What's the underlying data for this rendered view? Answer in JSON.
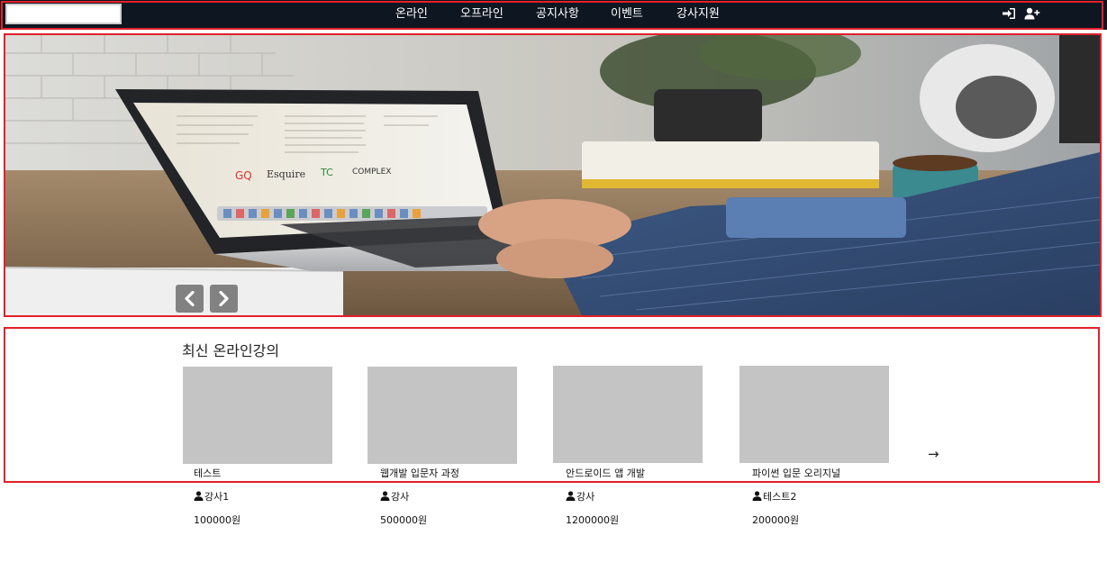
{
  "nav": {
    "menu": [
      "온라인",
      "오프라인",
      "공지사항",
      "이벤트",
      "강사지원"
    ]
  },
  "section": {
    "title": "최신 온라인강의",
    "next": "→",
    "courses": [
      {
        "title": "테스트",
        "instructor": "강사1",
        "price": "100000원"
      },
      {
        "title": "웹개발 입문자 과정",
        "instructor": "강사",
        "price": "500000원"
      },
      {
        "title": "안드로이드 앱 개발",
        "instructor": "강사",
        "price": "1200000원"
      },
      {
        "title": "파이썬 입문 오리지널",
        "instructor": "테스트2",
        "price": "200000원"
      }
    ]
  },
  "colors": {
    "navbar": "#0e1621",
    "highlight_border": "#e3202a",
    "thumbnail": "#c4c4c4"
  }
}
